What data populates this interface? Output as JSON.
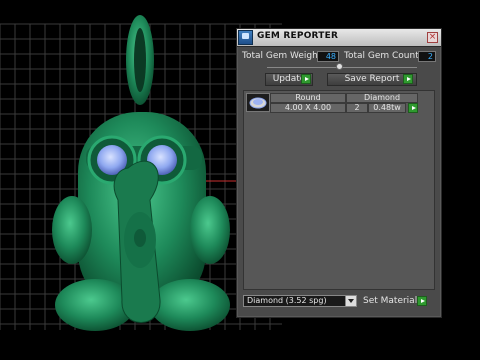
{
  "panel": {
    "title": "GEM REPORTER",
    "total_gem_weight_label": "Total Gem Weight",
    "total_gem_weight_value": "48",
    "total_gem_count_label": "Total Gem Count",
    "total_gem_count_value": "2",
    "update_label": "Update",
    "save_report_label": "Save Report",
    "table": {
      "col1_header": "Round",
      "col2_header": "Diamond",
      "row": {
        "size": "4.00 X 4.00",
        "count": "2",
        "weight": "0.48tw"
      }
    },
    "material_select_value": "Diamond   (3.52 spg)",
    "set_material_label": "Set Material"
  },
  "colors": {
    "model_green": "#1e8a5a",
    "gem_blue": "#8fa8f0",
    "accent_green": "#2f9a2f",
    "value_blue": "#3ab0ff"
  },
  "icons": [
    "app-icon",
    "close-icon",
    "gem-thumbnail-icon",
    "dropdown-arrow-icon",
    "go-arrow-icon"
  ]
}
